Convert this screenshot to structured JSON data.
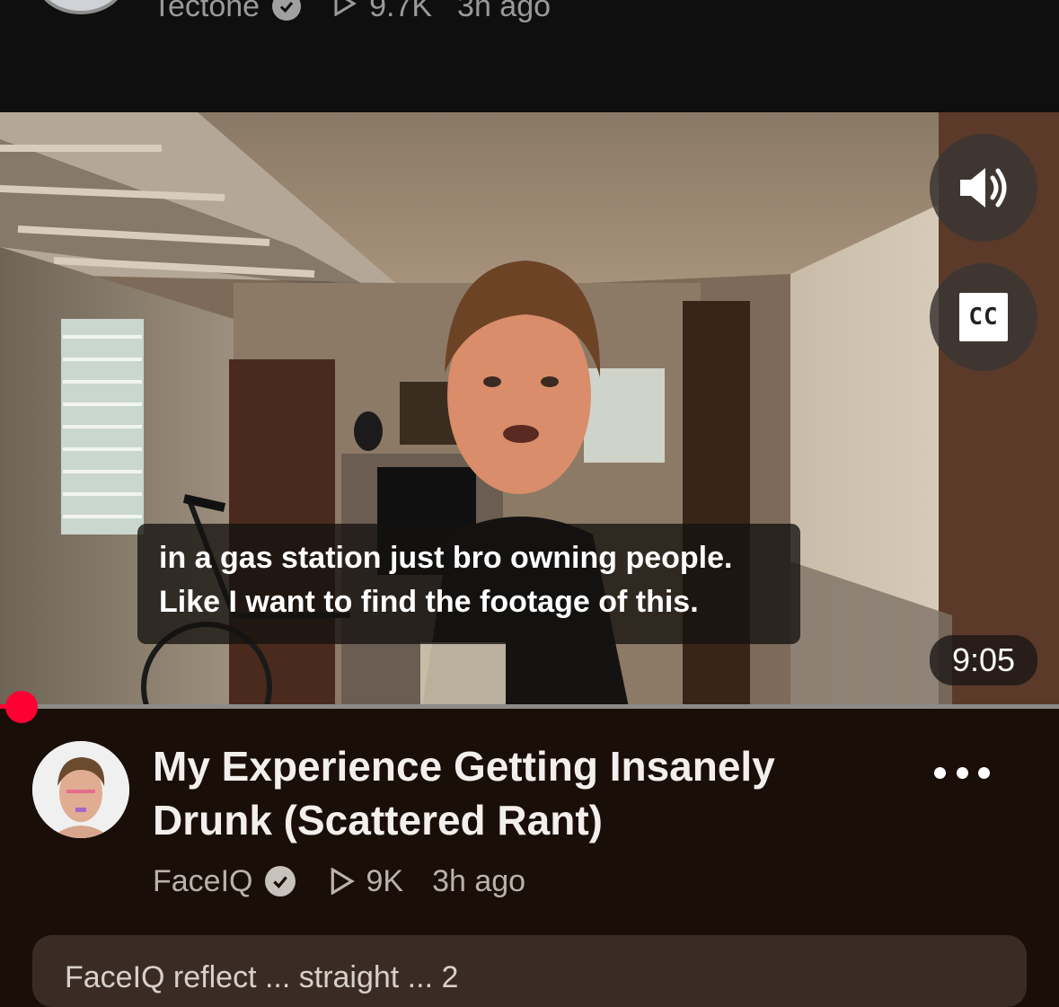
{
  "previous_item": {
    "channel": "Tectone",
    "views": "9.7K",
    "age": "3h ago"
  },
  "player": {
    "caption_lines": [
      "in a gas station just bro owning people.",
      "Like I want to find the footage of this."
    ],
    "duration": "9:05",
    "cc_label": "CC",
    "progress_fraction": 0.02,
    "accent_color": "#ff0033"
  },
  "video": {
    "title_lines": [
      "My Experience Getting Insanely",
      "Drunk (Scattered Rant)"
    ],
    "channel": "FaceIQ",
    "views": "9K",
    "age": "3h ago"
  },
  "comments": {
    "preview": "FaceIQ reflect ... straight ... 2"
  },
  "icons": {
    "volume": "volume-icon",
    "captions": "closed-captions-icon",
    "verified": "verified-check-icon",
    "views": "play-triangle-icon",
    "more": "more-options-icon"
  }
}
